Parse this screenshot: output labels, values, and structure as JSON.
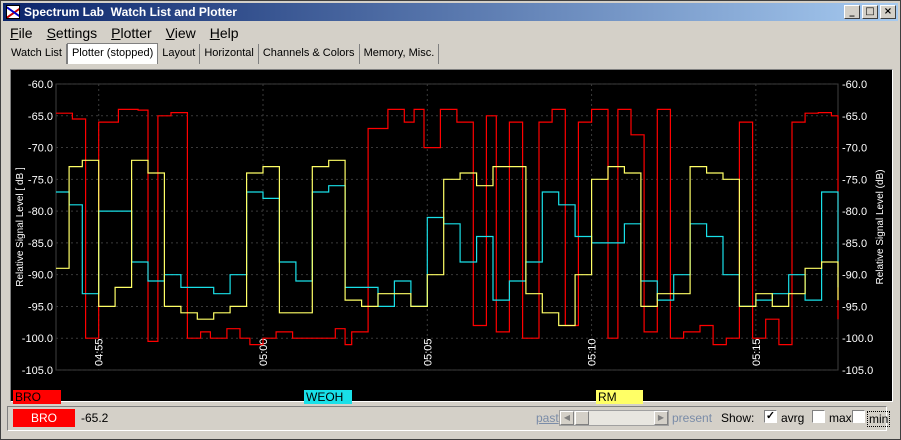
{
  "window": {
    "title": "Spectrum Lab  Watch List and Plotter",
    "controls": [
      "_",
      "□",
      "×"
    ]
  },
  "menu": [
    {
      "label": "File",
      "accel": "F"
    },
    {
      "label": "Settings",
      "accel": "S"
    },
    {
      "label": "Plotter",
      "accel": "P"
    },
    {
      "label": "View",
      "accel": "V"
    },
    {
      "label": "Help",
      "accel": "H"
    }
  ],
  "tabs": [
    {
      "label": "Watch List",
      "active": false
    },
    {
      "label": "Plotter (stopped)",
      "active": true
    },
    {
      "label": "Layout",
      "active": false
    },
    {
      "label": "Horizontal",
      "active": false
    },
    {
      "label": "Channels & Colors",
      "active": false
    },
    {
      "label": "Memory, Misc.",
      "active": false
    }
  ],
  "chart_data": {
    "type": "line",
    "ylabel_left": "Relative Signal Level [ dB ]",
    "ylabel_right": "Relative Signal Level (dB)",
    "ylim": [
      -105,
      -60
    ],
    "yticks": [
      "-60.0",
      "-65.0",
      "-70.0",
      "-75.0",
      "-80.0",
      "-85.0",
      "-90.0",
      "-95.0",
      "-100.0",
      "-105.0"
    ],
    "xticks": [
      "04:55",
      "05:00",
      "05:05",
      "05:10",
      "05:15"
    ],
    "xlim_minutes": [
      53.7,
      77.5
    ],
    "grid": true,
    "background": "#000000",
    "series": [
      {
        "name": "BRO",
        "color": "#ff0000",
        "x": [
          53.7,
          54.2,
          54.6,
          55.0,
          55.6,
          56.2,
          56.5,
          56.8,
          57.2,
          57.7,
          58.1,
          58.4,
          58.9,
          59.3,
          59.6,
          60.0,
          60.4,
          60.9,
          61.3,
          61.8,
          62.2,
          62.5,
          62.7,
          63.2,
          63.8,
          64.3,
          64.6,
          64.9,
          65.4,
          65.9,
          66.4,
          66.8,
          67.1,
          67.5,
          67.9,
          68.4,
          68.8,
          69.2,
          69.6,
          70.0,
          70.5,
          70.8,
          71.2,
          71.6,
          72.0,
          72.4,
          72.8,
          73.3,
          73.7,
          74.1,
          74.5,
          74.9,
          75.3,
          75.7,
          76.1,
          76.5,
          76.9,
          77.3,
          77.5
        ],
        "y": [
          -64.6,
          -65.5,
          -100,
          -66.0,
          -64.0,
          -64.1,
          -100.5,
          -65.0,
          -64.5,
          -100,
          -99,
          -100,
          -98.5,
          -100,
          -101,
          -100,
          -99,
          -100,
          -100,
          -100,
          -98.5,
          -101,
          -99,
          -67,
          -64,
          -66,
          -64,
          -70,
          -64,
          -66,
          -98,
          -65,
          -99,
          -66,
          -100,
          -66,
          -64,
          -98,
          -66,
          -64,
          -100,
          -64,
          -68,
          -99,
          -64,
          -100,
          -99,
          -98,
          -101,
          -100,
          -66,
          -100,
          -97,
          -101,
          -66,
          -64.6,
          -64.5,
          -65,
          -97
        ]
      },
      {
        "name": "WEOH",
        "color": "#19e0e8",
        "x": [
          53.7,
          54.1,
          54.5,
          55.0,
          55.5,
          56.0,
          56.5,
          57.0,
          57.5,
          58.0,
          58.5,
          59.0,
          59.5,
          60.0,
          60.5,
          61.0,
          61.5,
          62.0,
          62.5,
          63.0,
          63.5,
          64.0,
          64.5,
          65.0,
          65.5,
          66.0,
          66.5,
          67.0,
          67.5,
          68.0,
          68.5,
          69.0,
          69.5,
          70.0,
          70.5,
          71.0,
          71.5,
          72.0,
          72.5,
          73.0,
          73.5,
          74.0,
          74.5,
          75.0,
          75.5,
          76.0,
          76.5,
          77.0,
          77.5
        ],
        "y": [
          -77,
          -79,
          -93,
          -80,
          -80,
          -88,
          -91,
          -90,
          -92,
          -92,
          -93,
          -90,
          -77,
          -78,
          -88,
          -91,
          -77,
          -76,
          -92,
          -92,
          -95,
          -91,
          -95,
          -81,
          -82,
          -88,
          -84,
          -94,
          -91,
          -88,
          -77,
          -79,
          -84,
          -85,
          -85,
          -82,
          -91,
          -94,
          -90,
          -82,
          -84,
          -90,
          -95,
          -94,
          -93,
          -90,
          -94,
          -77,
          -92
        ]
      },
      {
        "name": "RM",
        "color": "#ffff66",
        "x": [
          53.7,
          54.1,
          54.5,
          55.0,
          55.5,
          56.0,
          56.5,
          57.0,
          57.5,
          58.0,
          58.5,
          59.0,
          59.5,
          60.0,
          60.5,
          61.0,
          61.5,
          62.0,
          62.5,
          63.0,
          63.5,
          64.0,
          64.5,
          65.0,
          65.5,
          66.0,
          66.5,
          67.0,
          67.5,
          68.0,
          68.5,
          69.0,
          69.5,
          70.0,
          70.5,
          71.0,
          71.5,
          72.0,
          72.5,
          73.0,
          73.5,
          74.0,
          74.5,
          75.0,
          75.5,
          76.0,
          76.5,
          77.0,
          77.5
        ],
        "y": [
          -89,
          -73,
          -72,
          -95,
          -92,
          -72,
          -74,
          -95,
          -96,
          -97,
          -96,
          -95,
          -74,
          -73,
          -96,
          -96,
          -73,
          -72,
          -94,
          -95,
          -93,
          -93,
          -95,
          -90,
          -75,
          -74,
          -76,
          -73,
          -73,
          -93,
          -96,
          -98,
          -90,
          -75,
          -73,
          -74,
          -95,
          -93,
          -93,
          -73,
          -74,
          -75,
          -95,
          -93,
          -95,
          -93,
          -89,
          -88,
          -94
        ]
      }
    ]
  },
  "legend": [
    {
      "label": "BRO",
      "color": "#ff0000"
    },
    {
      "label": "WEOH",
      "color": "#19e0e8"
    },
    {
      "label": "RM",
      "color": "#ffff66"
    }
  ],
  "status": {
    "readout_label": "BRO",
    "readout_value": "-65.2",
    "past_label": "past",
    "present_label": "present",
    "show_label": "Show:",
    "avrg_label": "avrg",
    "avrg_checked": true,
    "max_label": "max",
    "max_checked": false,
    "min_label": "min",
    "min_checked": false
  }
}
